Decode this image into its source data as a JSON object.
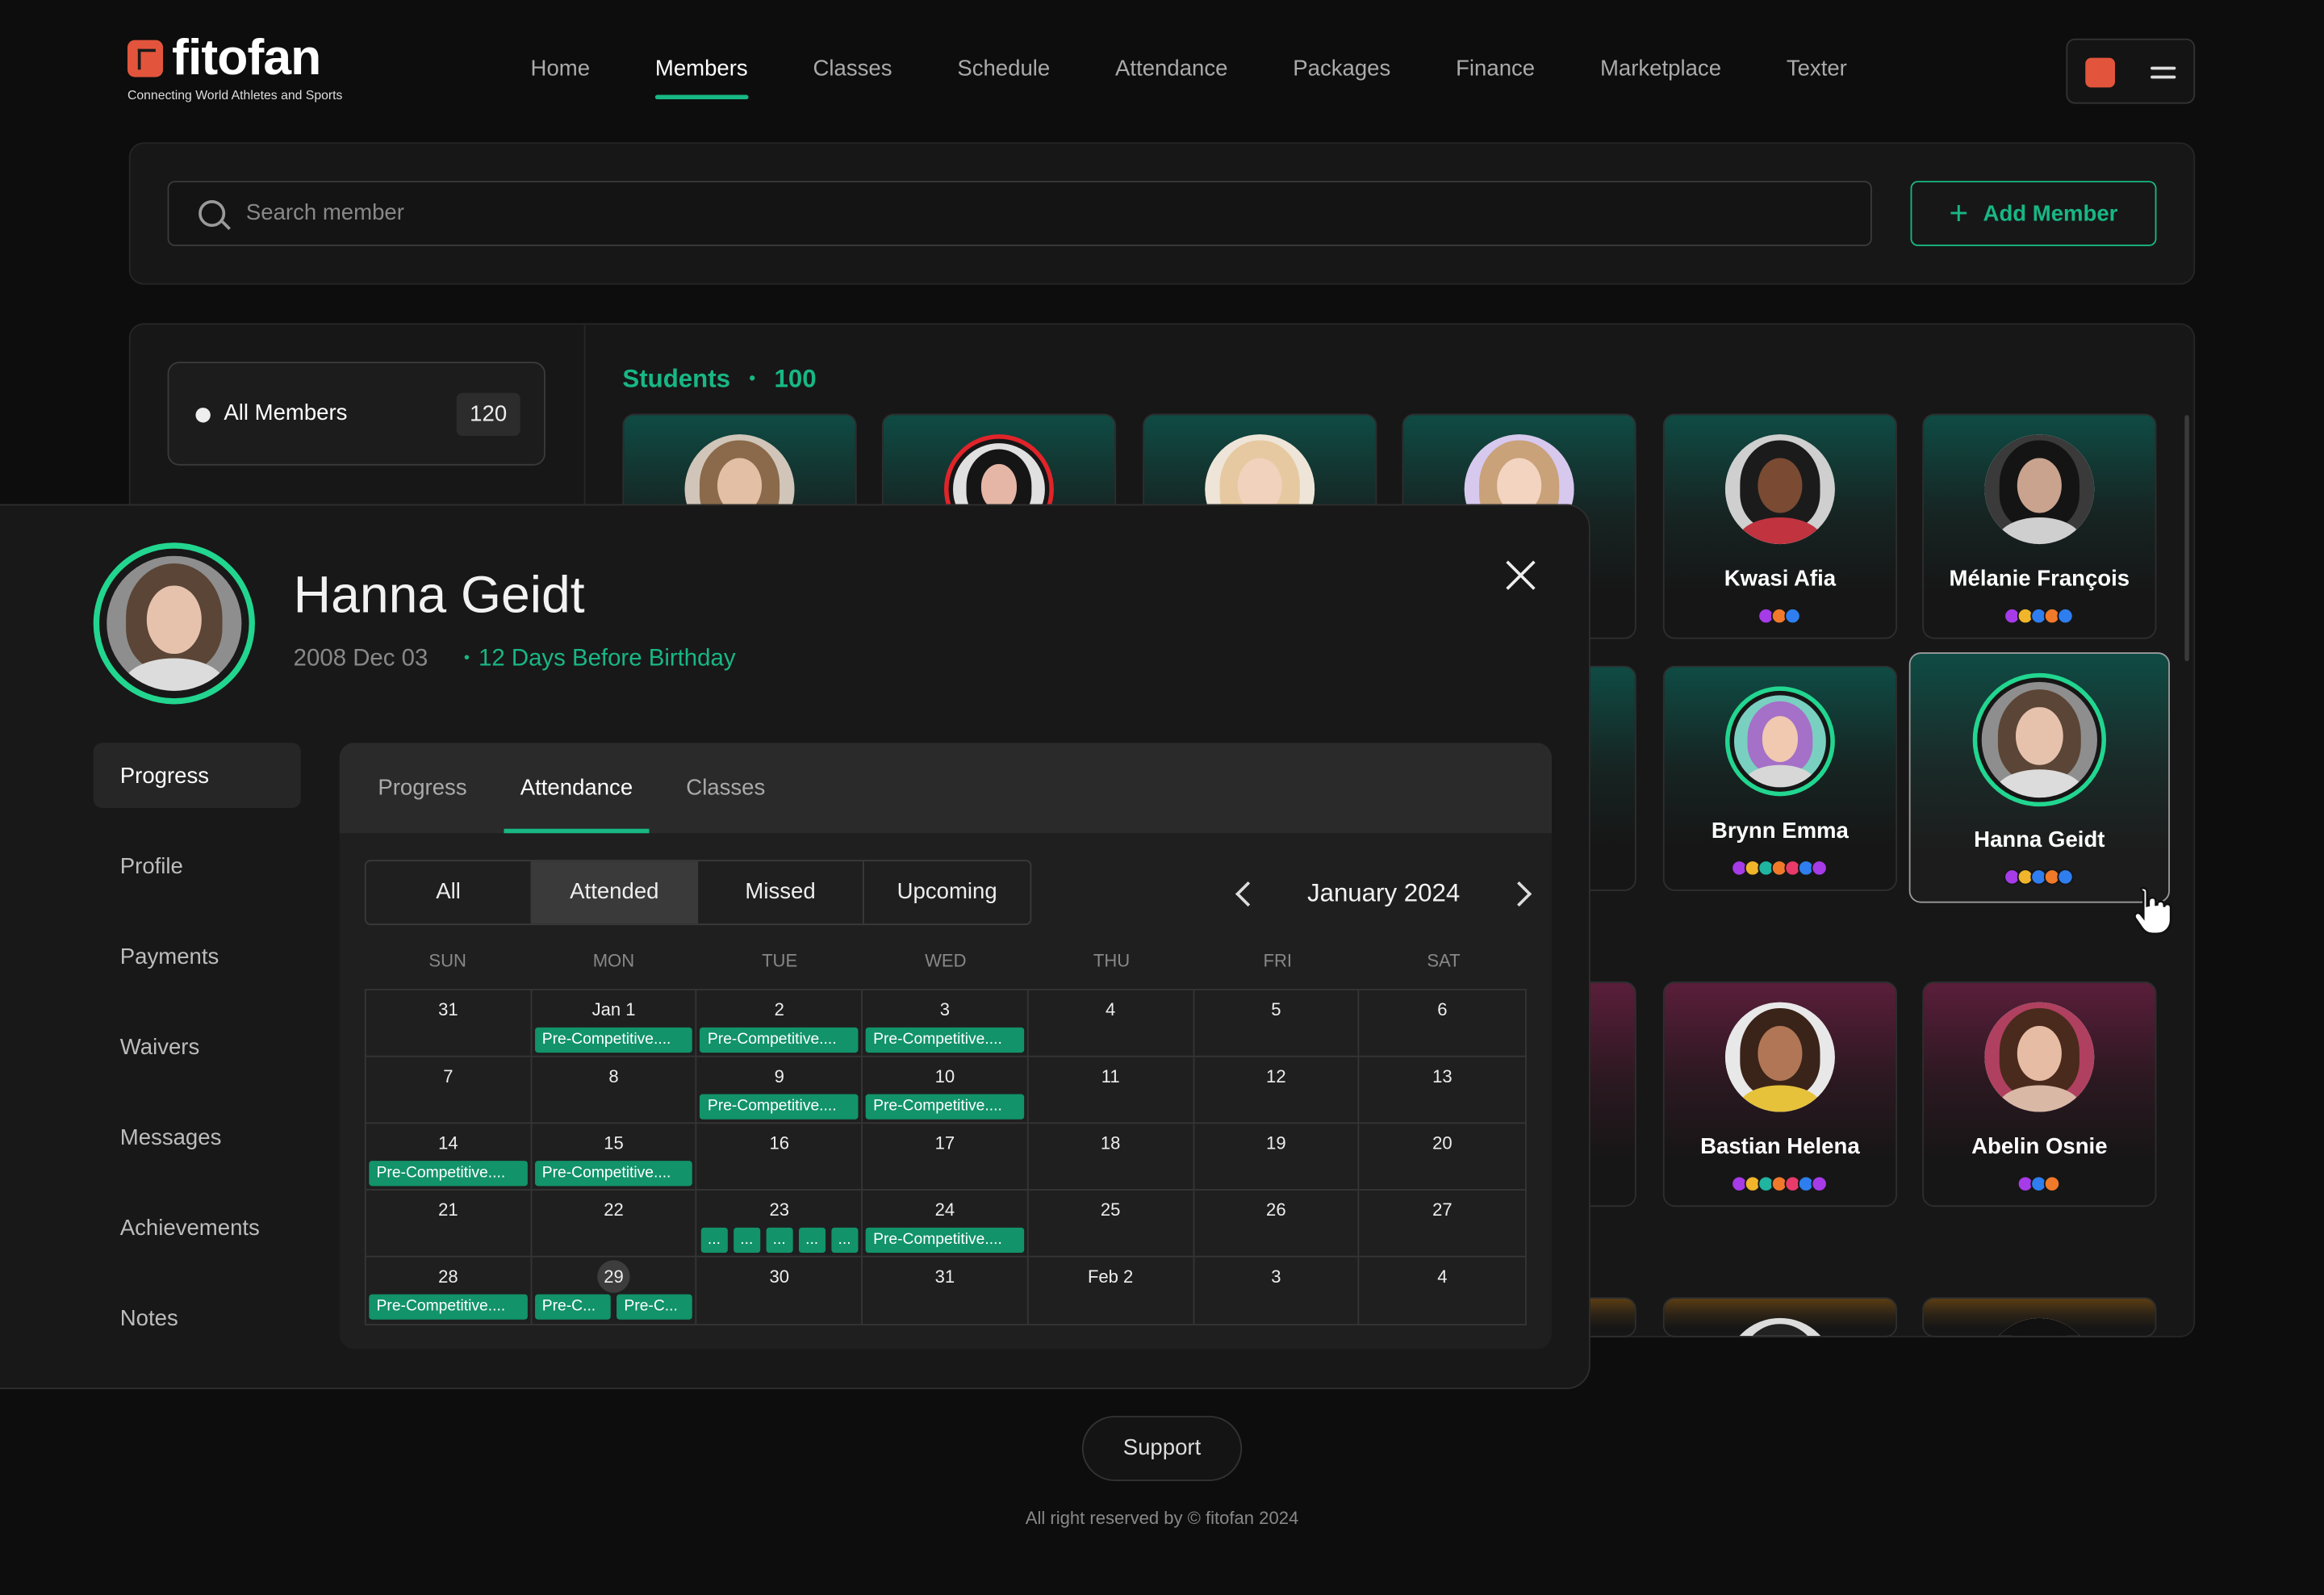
{
  "brand": {
    "name": "fitofan",
    "tagline": "Connecting World Athletes and Sports",
    "accent": "#18b784"
  },
  "nav": [
    {
      "label": "Home"
    },
    {
      "label": "Members",
      "active": true
    },
    {
      "label": "Classes"
    },
    {
      "label": "Schedule"
    },
    {
      "label": "Attendance"
    },
    {
      "label": "Packages"
    },
    {
      "label": "Finance"
    },
    {
      "label": "Marketplace"
    },
    {
      "label": "Texter"
    }
  ],
  "search": {
    "placeholder": "Search member",
    "add_label": "Add  Member"
  },
  "filter_all": {
    "label": "All Members",
    "count": "120"
  },
  "students": {
    "label": "Students",
    "count": "100"
  },
  "cards": [
    {
      "name": "Kwasi Afia",
      "dots": [
        "#a63be8",
        "#f07a2a",
        "#2f7ef0"
      ]
    },
    {
      "name": "Mélanie François",
      "dots": [
        "#a63be8",
        "#f0b52a",
        "#2f7ef0",
        "#f07a2a",
        "#2f7ef0"
      ]
    },
    {
      "name": "Brynn Emma",
      "dots": [
        "#a63be8",
        "#f0b52a",
        "#1fb5a0",
        "#f07a2a",
        "#e83b6a",
        "#2f7ef0",
        "#a63be8"
      ]
    },
    {
      "name": "Hanna Geidt",
      "dots": [
        "#a63be8",
        "#f0b52a",
        "#2f7ef0",
        "#f07a2a",
        "#2f7ef0"
      ]
    },
    {
      "name": "Bastian Helena",
      "dots": [
        "#a63be8",
        "#f0b52a",
        "#1fb5a0",
        "#f07a2a",
        "#e83b6a",
        "#2f7ef0",
        "#a63be8"
      ]
    },
    {
      "name": "Abelin Osnie",
      "dots": [
        "#a63be8",
        "#2f7ef0",
        "#f07a2a"
      ]
    }
  ],
  "profile": {
    "name": "Hanna Geidt",
    "dob": "2008 Dec 03",
    "birthday": "12 Days Before Birthday"
  },
  "side_nav": [
    {
      "label": "Progress",
      "active": true
    },
    {
      "label": "Profile"
    },
    {
      "label": "Payments"
    },
    {
      "label": "Waivers"
    },
    {
      "label": "Messages"
    },
    {
      "label": "Achievements"
    },
    {
      "label": "Notes"
    }
  ],
  "tabs": [
    {
      "label": "Progress"
    },
    {
      "label": "Attendance",
      "active": true
    },
    {
      "label": "Classes"
    }
  ],
  "filters": [
    {
      "label": "All"
    },
    {
      "label": "Attended",
      "active": true
    },
    {
      "label": "Missed"
    },
    {
      "label": "Upcoming"
    }
  ],
  "month": "January 2024",
  "weekdays": [
    "SUN",
    "MON",
    "TUE",
    "WED",
    "THU",
    "FRI",
    "SAT"
  ],
  "calendar": [
    [
      {
        "d": "31"
      },
      {
        "d": "Jan 1",
        "ev": [
          "Pre-Competitive...."
        ]
      },
      {
        "d": "2",
        "ev": [
          "Pre-Competitive...."
        ]
      },
      {
        "d": "3",
        "ev": [
          "Pre-Competitive...."
        ]
      },
      {
        "d": "4"
      },
      {
        "d": "5"
      },
      {
        "d": "6"
      }
    ],
    [
      {
        "d": "7"
      },
      {
        "d": "8"
      },
      {
        "d": "9",
        "ev": [
          "Pre-Competitive...."
        ]
      },
      {
        "d": "10",
        "ev": [
          "Pre-Competitive...."
        ]
      },
      {
        "d": "11"
      },
      {
        "d": "12"
      },
      {
        "d": "13"
      }
    ],
    [
      {
        "d": "14",
        "ev": [
          "Pre-Competitive...."
        ]
      },
      {
        "d": "15",
        "ev": [
          "Pre-Competitive...."
        ]
      },
      {
        "d": "16"
      },
      {
        "d": "17"
      },
      {
        "d": "18"
      },
      {
        "d": "19"
      },
      {
        "d": "20"
      }
    ],
    [
      {
        "d": "21"
      },
      {
        "d": "22"
      },
      {
        "d": "23",
        "tiny": [
          "...",
          "...",
          "...",
          "...",
          "..."
        ]
      },
      {
        "d": "24",
        "ev": [
          "Pre-Competitive...."
        ]
      },
      {
        "d": "25"
      },
      {
        "d": "26"
      },
      {
        "d": "27"
      }
    ],
    [
      {
        "d": "28",
        "ev": [
          "Pre-Competitive...."
        ]
      },
      {
        "d": "29",
        "today": true,
        "ev": [
          "Pre-C...",
          "Pre-C..."
        ]
      },
      {
        "d": "30"
      },
      {
        "d": "31"
      },
      {
        "d": "Feb 2"
      },
      {
        "d": "3"
      },
      {
        "d": "4"
      }
    ]
  ],
  "footer": {
    "support": "Support",
    "copyright": "All right reserved by © fitofan 2024"
  }
}
